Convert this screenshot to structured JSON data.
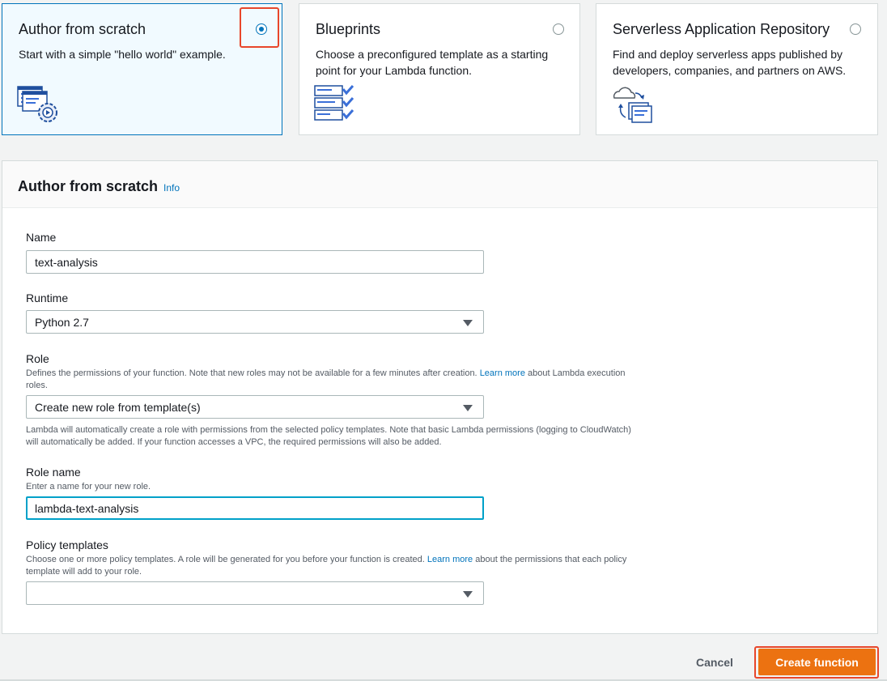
{
  "cards": [
    {
      "title": "Author from scratch",
      "description": "Start with a simple \"hello world\" example.",
      "selected": true,
      "icon": "code-gear-icon"
    },
    {
      "title": "Blueprints",
      "description": "Choose a preconfigured template as a starting point for your Lambda function.",
      "selected": false,
      "icon": "blueprint-checklist-icon"
    },
    {
      "title": "Serverless Application Repository",
      "description": "Find and deploy serverless apps published by developers, companies, and partners on AWS.",
      "selected": false,
      "icon": "cloud-deploy-icon"
    }
  ],
  "form": {
    "title": "Author from scratch",
    "info_link": "Info",
    "name": {
      "label": "Name",
      "value": "text-analysis"
    },
    "runtime": {
      "label": "Runtime",
      "value": "Python 2.7"
    },
    "role": {
      "label": "Role",
      "help_before": "Defines the permissions of your function. Note that new roles may not be available for a few minutes after creation.",
      "help_link": "Learn more",
      "help_after": "about Lambda execution roles.",
      "value": "Create new role from template(s)",
      "note": "Lambda will automatically create a role with permissions from the selected policy templates. Note that basic Lambda permissions (logging to CloudWatch) will automatically be added. If your function accesses a VPC, the required permissions will also be added."
    },
    "role_name": {
      "label": "Role name",
      "help": "Enter a name for your new role.",
      "value": "lambda-text-analysis"
    },
    "policy_templates": {
      "label": "Policy templates",
      "help_before": "Choose one or more policy templates. A role will be generated for you before your function is created.",
      "help_link": "Learn more",
      "help_after": "about the permissions that each policy template will add to your role.",
      "value": ""
    }
  },
  "footer": {
    "cancel_label": "Cancel",
    "create_label": "Create function"
  },
  "colors": {
    "accent": "#0073bb",
    "primary_button": "#ec7211",
    "highlight": "#e8462b"
  }
}
